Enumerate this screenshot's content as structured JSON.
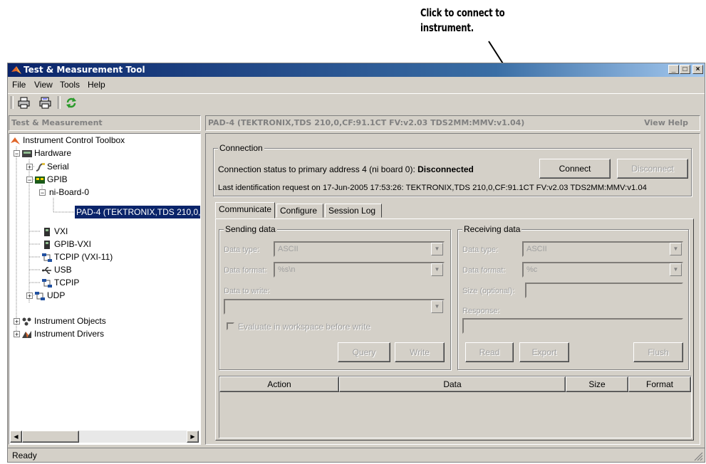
{
  "callout": {
    "line1": "Click to connect to",
    "line2": "instrument."
  },
  "window": {
    "title": "Test & Measurement Tool",
    "min": "_",
    "max": "□",
    "close": "×"
  },
  "menu": [
    "File",
    "View",
    "Tools",
    "Help"
  ],
  "toolbar": {
    "icons": [
      "print-icon",
      "print-preview-icon",
      "refresh-icon"
    ]
  },
  "left_pane": {
    "header": "Test & Measurement"
  },
  "tree": {
    "root": "Instrument Control Toolbox",
    "hardware": "Hardware",
    "serial": "Serial",
    "gpib": "GPIB",
    "board": "ni-Board-0",
    "pad": "PAD-4 (TEKTRONIX,TDS 210,0,",
    "vxi": "VXI",
    "gpibvxi": "GPIB-VXI",
    "tcpipvxi": "TCPIP (VXI-11)",
    "usb": "USB",
    "tcpip": "TCPIP",
    "udp": "UDP",
    "objects": "Instrument Objects",
    "drivers": "Instrument Drivers"
  },
  "right_pane": {
    "header": "PAD-4 (TEKTRONIX,TDS 210,0,CF:91.1CT FV:v2.03 TDS2MM:MMV:v1.04)",
    "help": "View Help"
  },
  "connection": {
    "title": "Connection",
    "status_prefix": "Connection status to primary address 4 (ni board 0): ",
    "status_value": "Disconnected",
    "ident": "Last identification request on 17-Jun-2005 17:53:26: TEKTRONIX,TDS 210,0,CF:91.1CT FV:v2.03 TDS2MM:MMV:v1.04",
    "connect": "Connect",
    "disconnect": "Disconnect"
  },
  "tabs": [
    "Communicate",
    "Configure",
    "Session Log"
  ],
  "sending": {
    "title": "Sending data",
    "type_label": "Data type:",
    "type_value": "ASCII",
    "format_label": "Data format:",
    "format_value": "%s\\n",
    "write_label": "Data to write:",
    "eval_label": "Evaluate in workspace before write",
    "query": "Query",
    "write": "Write"
  },
  "receiving": {
    "title": "Receiving data",
    "type_label": "Data type:",
    "type_value": "ASCII",
    "format_label": "Data format:",
    "format_value": "%c",
    "size_label": "Size (optional):",
    "response_label": "Response:",
    "read": "Read",
    "export": "Export",
    "flush": "Flush"
  },
  "table": {
    "columns": [
      "Action",
      "Data",
      "Size",
      "Format"
    ]
  },
  "status": "Ready"
}
